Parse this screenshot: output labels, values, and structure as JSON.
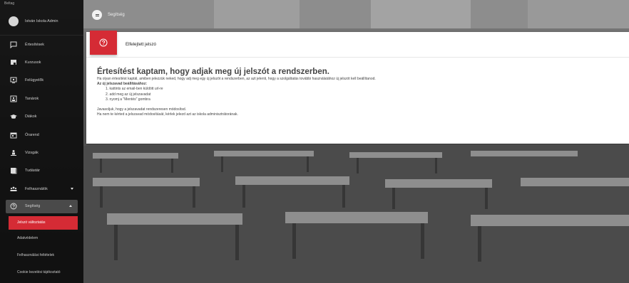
{
  "app": {
    "brand_text": "Beltag",
    "user_name": "István Iskola Admin"
  },
  "sidebar": {
    "items": [
      {
        "label": "Értesítések"
      },
      {
        "label": "Kurzusok"
      },
      {
        "label": "Felügyelők"
      },
      {
        "label": "Tanárok"
      },
      {
        "label": "Diákok"
      },
      {
        "label": "Órarend"
      },
      {
        "label": "Vizsgák"
      },
      {
        "label": "Tudástár"
      },
      {
        "label": "Felhasználók"
      },
      {
        "label": "Segítség"
      }
    ],
    "sub_items": [
      {
        "label": "Jelszó változtatás"
      },
      {
        "label": "Adatvédelem"
      },
      {
        "label": "Felhasználási feltételek"
      },
      {
        "label": "Cookie kezelési tájékoztató"
      }
    ]
  },
  "topbar": {
    "title": "Segítség"
  },
  "card": {
    "title": "Elfelejtett jelszó",
    "heading": "Értesítést kaptam, hogy adjak meg új jelszót a rendszerben.",
    "intro": "Ha olyan értesítést kaptál, amiben jelezzük neked, hogy adj meg egy új jelszót a rendszerben, az azt jelenti, hogy a szolgáltatás további használatához új jelszót kell beállítanod.",
    "steps_title": "Az új jelszavad beállításához:",
    "steps": [
      "1. kattints az email-ben küldött url-re",
      "2. add meg az új jelszavadat",
      "3. nyomj a \"Mentés\" gombra"
    ],
    "note1": "Javasoljuk, hogy a jelszavadat rendszeresen módosítsd.",
    "note2": "Ha nem te kérted a jelszavad módosítását, kérlek jelezd azt az iskola adminisztrátorának."
  },
  "colors": {
    "accent": "#d52b35",
    "sidebar_bg": "#0c0c0c",
    "card_bg": "#ffffff"
  }
}
